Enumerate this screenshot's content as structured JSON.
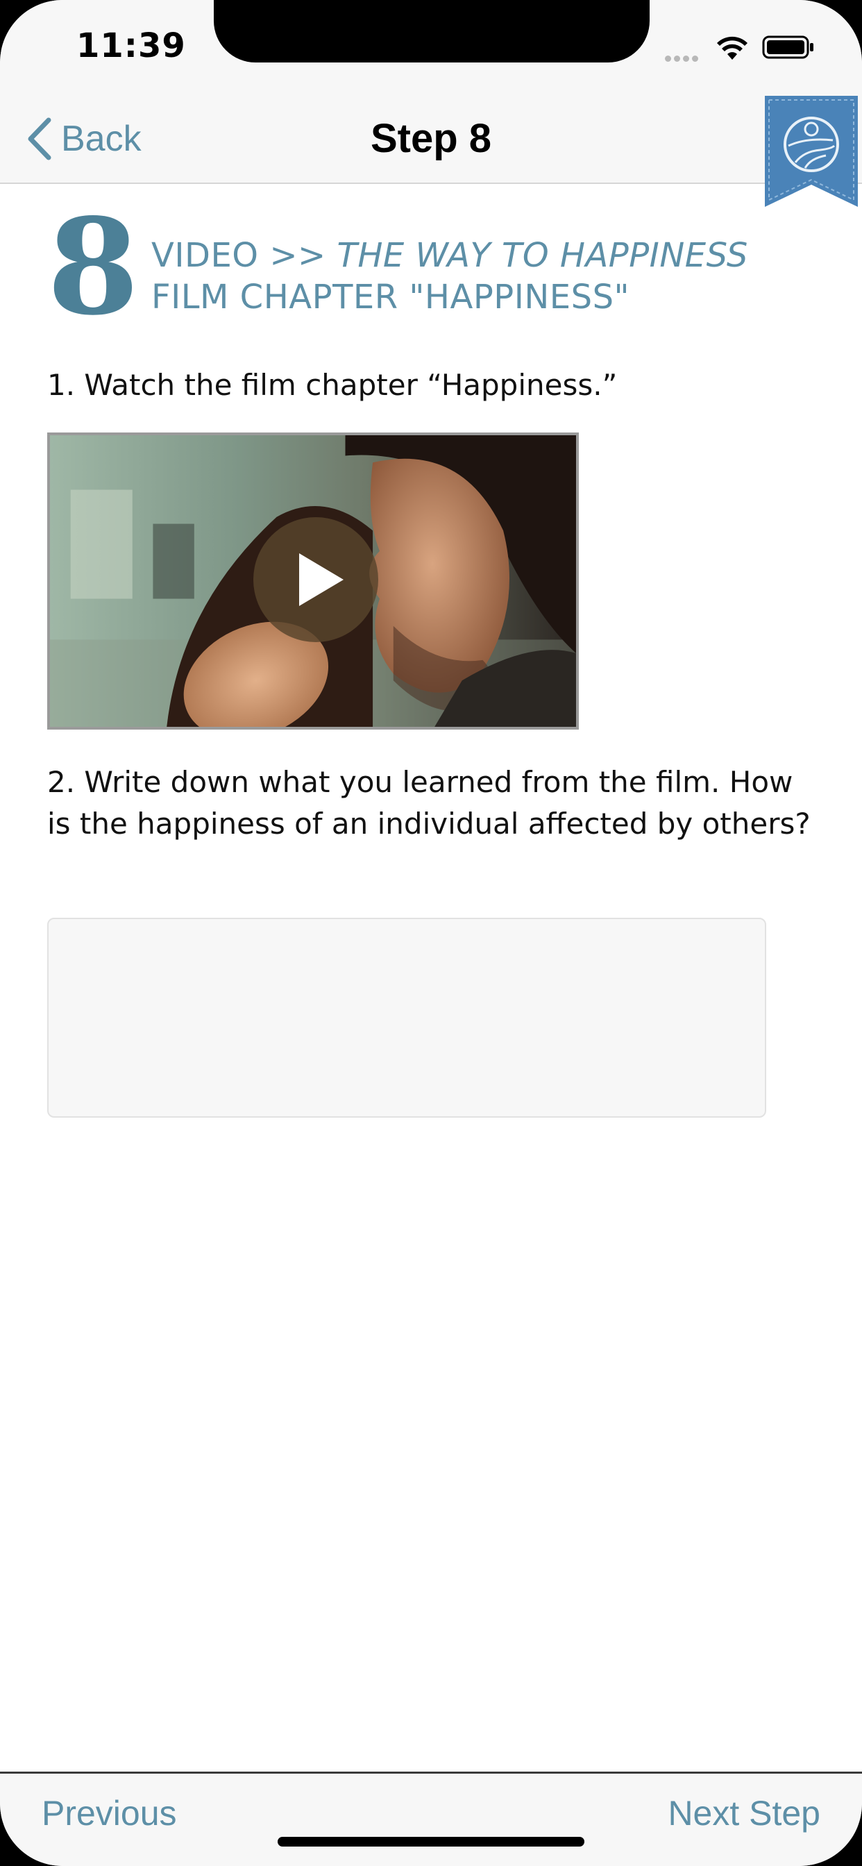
{
  "status_bar": {
    "time": "11:39"
  },
  "nav": {
    "back_label": "Back",
    "title": "Step 8"
  },
  "step": {
    "number": "8",
    "heading_prefix": "VIDEO >> ",
    "heading_film_italic": "THE WAY TO HAPPINESS",
    "heading_suffix": " FILM CHAPTER \"HAPPINESS\""
  },
  "instructions": {
    "item1": "1. Watch the film chapter “Happiness.”",
    "item2": "2. Write down what you learned from the film. How is the happiness of an individual affected by others?"
  },
  "answer_box": {
    "value": ""
  },
  "toolbar": {
    "previous_label": "Previous",
    "next_label": "Next Step"
  },
  "colors": {
    "accent": "#5d8fa7",
    "step_number": "#4c8097",
    "bookmark": "#4a83b8"
  },
  "icons": {
    "back": "chevron-left-icon",
    "bookmark": "bookmark-ribbon-icon",
    "play": "play-icon"
  }
}
